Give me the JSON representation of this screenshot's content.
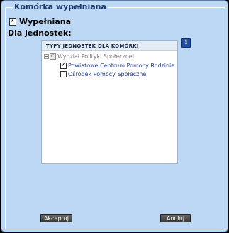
{
  "fieldset": {
    "legend": "Komórka wypełniana"
  },
  "wypelniana": {
    "label": "Wypełniana",
    "checked": true
  },
  "dla_jednostek": {
    "label": "Dla jednostek:"
  },
  "info_icon": {
    "glyph": "i",
    "icon": "info-icon"
  },
  "tree": {
    "header": "TYPY JEDNOSTEK DLA KOMÓRKI",
    "root": {
      "label": "Wydział Polityki Społecznej",
      "checked": true,
      "disabled": true
    },
    "children": [
      {
        "label": "Powiatowe Centrum Pomocy Rodzinie",
        "checked": true
      },
      {
        "label": "Ośrodek Pomocy Społecznej",
        "checked": false
      }
    ]
  },
  "buttons": {
    "accept_label": "Akceptuj",
    "cancel_label": "Anuluj"
  }
}
